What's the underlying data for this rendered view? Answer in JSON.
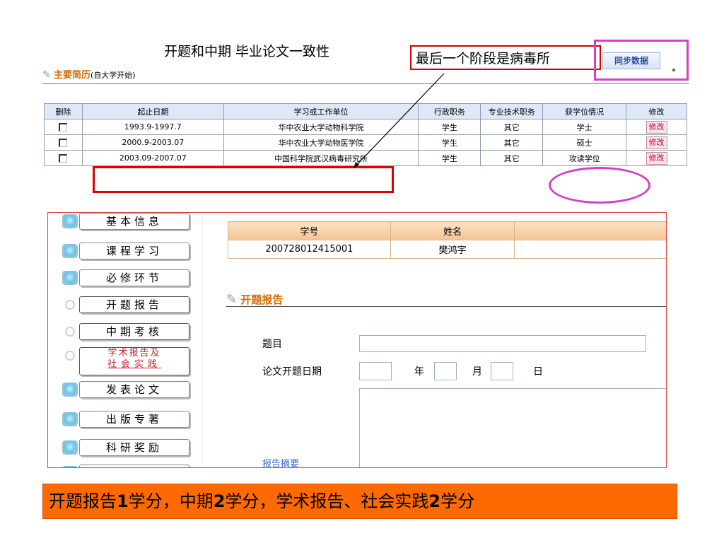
{
  "annotations": {
    "consistency_note": "开题和中期 毕业论文一致性",
    "last_stage_note": "最后一个阶段是病毒所",
    "summary_part1": "开题报告",
    "summary_bold1": "1",
    "summary_part2": "学分，中期",
    "summary_bold2": "2",
    "summary_part3": "学分，学术报告、社会实践",
    "summary_bold3": "2",
    "summary_part4": "学分"
  },
  "resume": {
    "section_title": "主要简历",
    "section_subtitle": "(自大学开始)",
    "sync_button": "同步数据",
    "headers": [
      "删除",
      "起止日期",
      "学习或工作单位",
      "行政职务",
      "专业技术职务",
      "获学位情况",
      "修改"
    ],
    "rows": [
      {
        "dates": "1993.9-1997.7",
        "unit": "华中农业大学动物科学院",
        "admin": "学生",
        "tech": "其它",
        "degree": "学士",
        "edit": "修改"
      },
      {
        "dates": "2000.9-2003.07",
        "unit": "华中农业大学动物医学院",
        "admin": "学生",
        "tech": "其它",
        "degree": "硕士",
        "edit": "修改"
      },
      {
        "dates": "2003.09-2007.07",
        "unit": "中国科学院武汉病毒研究所",
        "admin": "学生",
        "tech": "其它",
        "degree": "攻读学位",
        "edit": "修改"
      }
    ]
  },
  "menu": {
    "items": [
      "基本信息",
      "课程学习",
      "必修环节",
      "开题报告",
      "中期考核",
      "学术报告及",
      "社会实践",
      "发表论文",
      "出版专著",
      "科研奖励"
    ]
  },
  "student": {
    "col_id": "学号",
    "col_name": "姓名",
    "id": "200728012415001",
    "name": "樊鸿宇"
  },
  "form": {
    "title": "开题报告",
    "topic_label": "题目",
    "date_label": "论文开题日期",
    "year_label": "年",
    "month_label": "月",
    "day_label": "日",
    "abstract_label": "报告摘要"
  },
  "colors": {
    "accent_orange": "#d56b00",
    "highlight_red": "#e00000",
    "highlight_magenta": "#d63ec9",
    "summary_bg": "#ff6a00"
  }
}
